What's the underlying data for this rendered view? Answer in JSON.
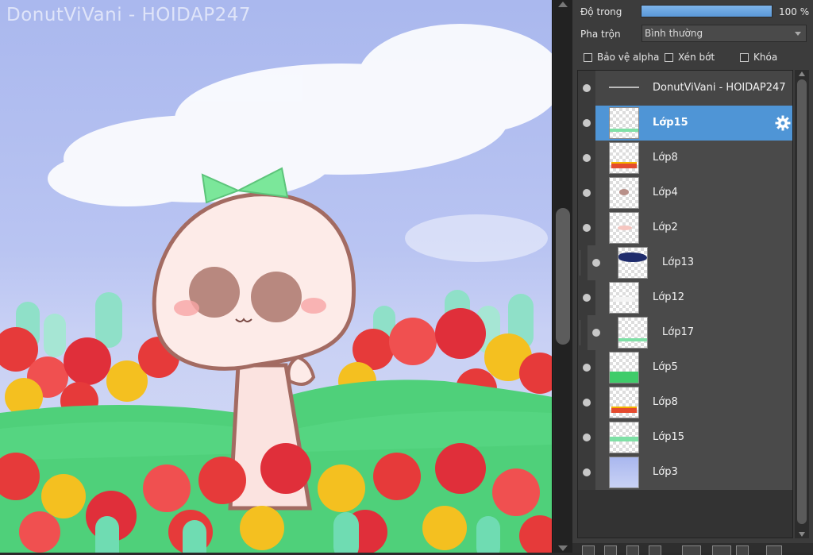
{
  "canvas": {
    "watermark": "DonutViVani - HOIDAP247"
  },
  "layer_panel": {
    "opacity_label": "Độ trong",
    "opacity_value": "100 %",
    "opacity_fraction": 1.0,
    "blend_label": "Pha trộn",
    "blend_value": "Bình thường",
    "protect_alpha_label": "Bảo vệ alpha",
    "clipping_label": "Xén bớt",
    "lock_label": "Khóa",
    "layers": [
      {
        "name": "DonutViVani - HOIDAP247",
        "kind": "text"
      },
      {
        "name": "Lớp15",
        "kind": "selected"
      },
      {
        "name": "Lớp8"
      },
      {
        "name": "Lớp4"
      },
      {
        "name": "Lớp2"
      },
      {
        "name": "Lớp13",
        "kind": "clipped"
      },
      {
        "name": "Lớp12"
      },
      {
        "name": "Lớp17",
        "kind": "clipped"
      },
      {
        "name": "Lớp5"
      },
      {
        "name": "Lớp8"
      },
      {
        "name": "Lớp15"
      },
      {
        "name": "Lớp3"
      }
    ]
  },
  "colors": {
    "selected_layer": "#4f95d6",
    "opacity_bar": "#5f9edd",
    "panel_bg": "#3c3c3c"
  }
}
